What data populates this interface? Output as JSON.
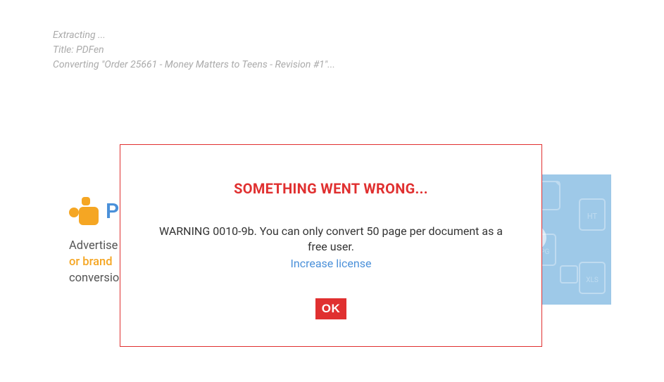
{
  "status": {
    "line1": "Extracting ...",
    "line2": "Title: PDFen",
    "line3": "Converting \"Order 25661 - Money Matters to Teens - Revision #1\"..."
  },
  "background": {
    "logo_text": "P",
    "promo_text1": "Advertise",
    "promo_highlight": "or brand",
    "promo_text2": "conversio"
  },
  "modal": {
    "title": "SOMETHING WENT WRONG...",
    "warning": "WARNING 0010-9b. You can only convert 50 page per document as a free user.",
    "link_text": "Increase license",
    "ok_button": "OK"
  }
}
